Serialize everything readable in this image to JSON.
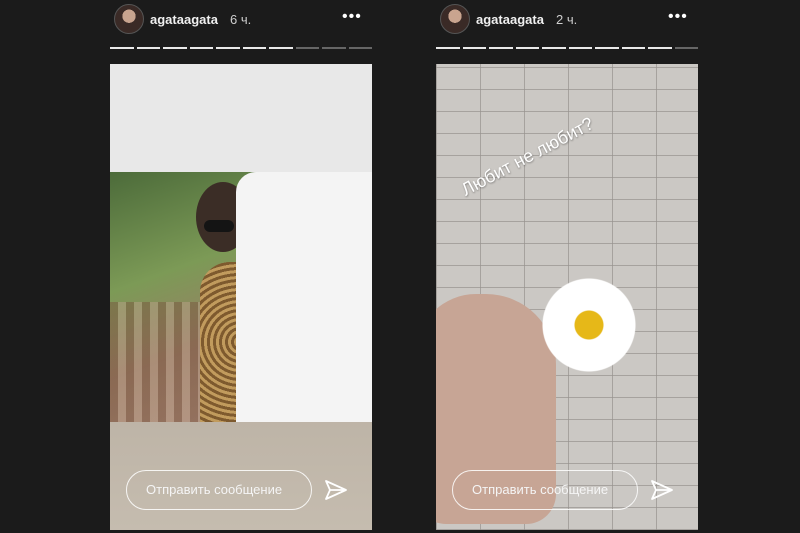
{
  "stories": [
    {
      "username": "agataagata",
      "time": "6 ч.",
      "more_label": "•••",
      "progress_segments": 10,
      "active_segments": 7,
      "reply_placeholder": "Отправить сообщение",
      "send_icon": "paper-plane-icon"
    },
    {
      "username": "agataagata",
      "time": "2 ч.",
      "more_label": "•••",
      "progress_segments": 10,
      "active_segments": 9,
      "caption": "Любит не любит?",
      "reply_placeholder": "Отправить сообщение",
      "send_icon": "paper-plane-icon"
    }
  ]
}
